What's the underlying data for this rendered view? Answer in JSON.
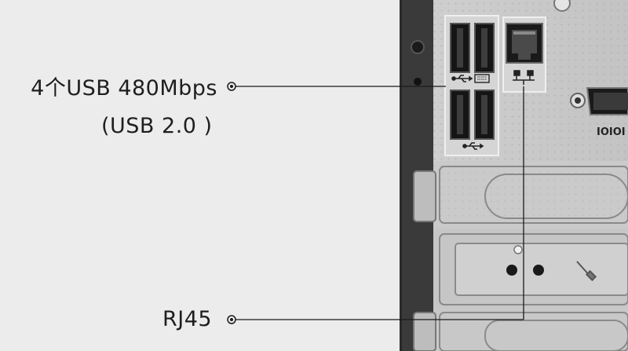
{
  "callouts": {
    "usb_heading": "4个USB 480Mbps",
    "usb_detail": "(USB 2.0 )",
    "rj45": "RJ45"
  },
  "panel": {
    "serial_port_label": "IOIOI"
  },
  "icons": {
    "usb_top": "usb-symbol-icon",
    "keyboard": "keyboard-icon",
    "usb_bottom": "usb-symbol-icon",
    "network": "network-icon",
    "screwdriver": "screwdriver-icon"
  },
  "colors": {
    "background": "#ececec",
    "chassis_dark": "#2a2a2a",
    "metal": "#c9c9c9",
    "leader_line": "#1a1a1a"
  }
}
